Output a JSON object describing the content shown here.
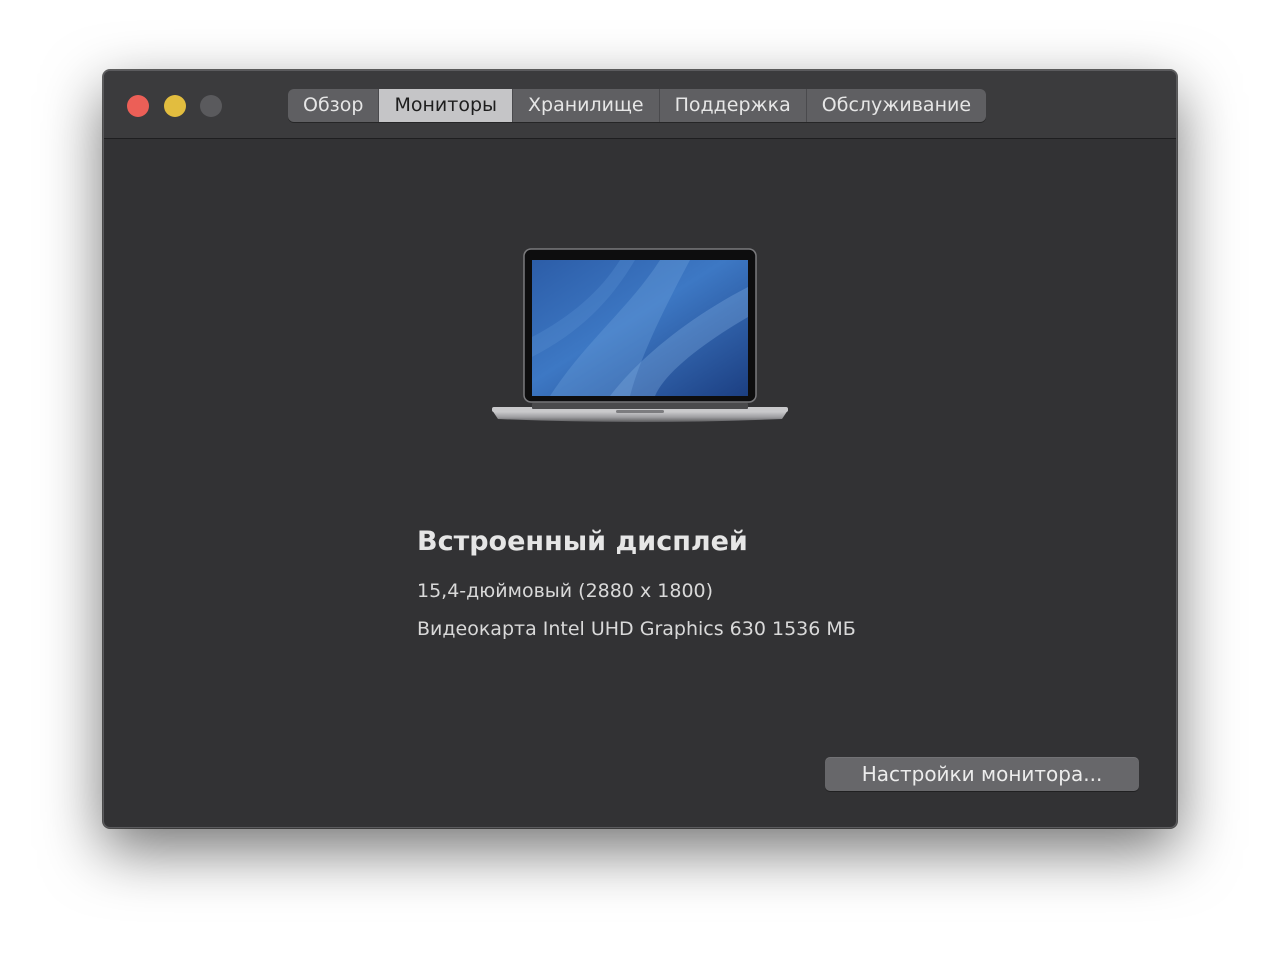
{
  "window": {
    "traffic_lights": {
      "close_color": "#ec5f57",
      "minimize_color": "#e2bd3f",
      "zoom_color": "#5a5a5d"
    }
  },
  "tabs": [
    {
      "label": "Обзор",
      "active": false
    },
    {
      "label": "Мониторы",
      "active": true
    },
    {
      "label": "Хранилище",
      "active": false
    },
    {
      "label": "Поддержка",
      "active": false
    },
    {
      "label": "Обслуживание",
      "active": false
    }
  ],
  "display": {
    "image": "macbook-pro-icon",
    "name": "Встроенный дисплей",
    "size_resolution": "15,4-дюймовый (2880 x 1800)",
    "graphics": "Видеокарта Intel UHD Graphics 630 1536 МБ"
  },
  "actions": {
    "display_settings_label": "Настройки монитора..."
  }
}
